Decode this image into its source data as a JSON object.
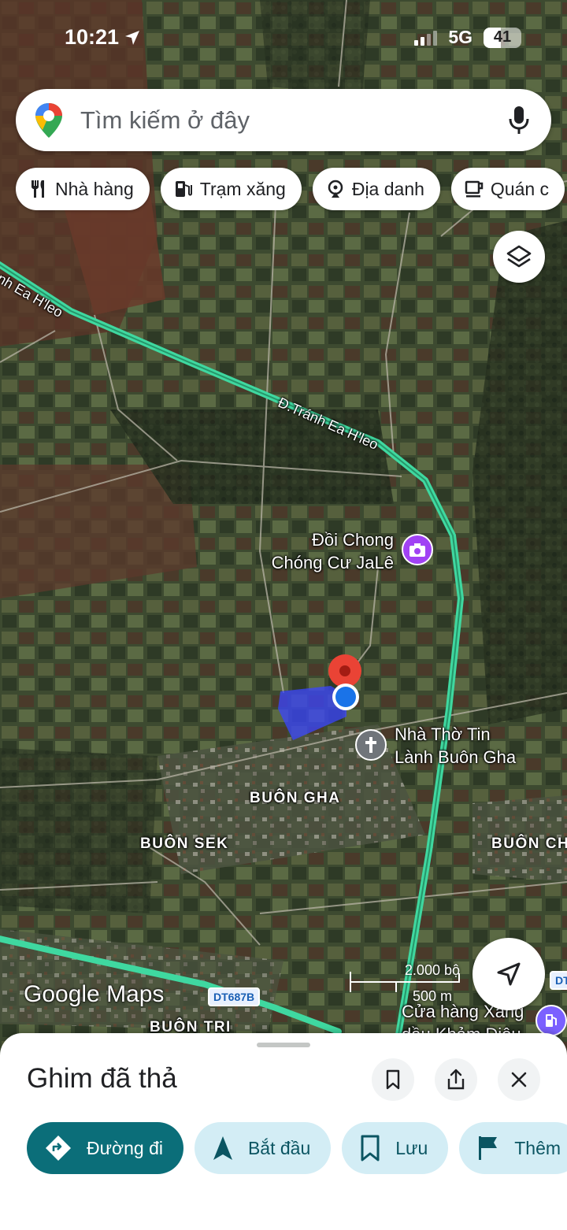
{
  "status_bar": {
    "time": "10:21",
    "network": "5G",
    "battery": "41"
  },
  "search": {
    "placeholder": "Tìm kiếm ở đây"
  },
  "chips": [
    {
      "label": "Nhà hàng",
      "icon": "restaurant-icon"
    },
    {
      "label": "Trạm xăng",
      "icon": "gas-station-icon"
    },
    {
      "label": "Địa danh",
      "icon": "landmark-icon"
    },
    {
      "label": "Quán c",
      "icon": "coffee-icon"
    }
  ],
  "map": {
    "roads": {
      "road_left": "nh Ea H'leo",
      "road_center": "Đ.Tránh Ea H'leo",
      "route_shield": "DT687B",
      "route_shield_right": "DT"
    },
    "pois": {
      "hill": {
        "line1": "Đồi Chong",
        "line2": "Chóng Cư JaLê",
        "color": "#a142f4"
      },
      "church": {
        "line1": "Nhà Thờ Tin",
        "line2": "Lành Buôn Gha",
        "color": "#70757a"
      },
      "gas": {
        "line1": "Cửa hàng Xăng",
        "line2": "dầu Khảm Diệu",
        "color": "#7b61ff"
      }
    },
    "areas": {
      "buon_gha": "BUÔN GHA",
      "buon_sek": "BUÔN SEK",
      "buon_ch": "BUÔN CH",
      "buon_tri": "BUÔN TRI"
    },
    "scale": {
      "imperial": "2.000 bộ",
      "metric": "500 m"
    },
    "watermark": "Google Maps",
    "colors": {
      "route": "#3fd8a0",
      "pin": "#ea4335",
      "location": "#1a73e8",
      "parcel": "#3b45ff"
    }
  },
  "sheet": {
    "title": "Ghim đã thả",
    "actions": [
      {
        "label": "Đường đi",
        "icon": "directions-icon"
      },
      {
        "label": "Bắt đầu",
        "icon": "navigation-start-icon"
      },
      {
        "label": "Lưu",
        "icon": "bookmark-icon"
      },
      {
        "label": "Thêm",
        "icon": "flag-icon"
      }
    ]
  }
}
